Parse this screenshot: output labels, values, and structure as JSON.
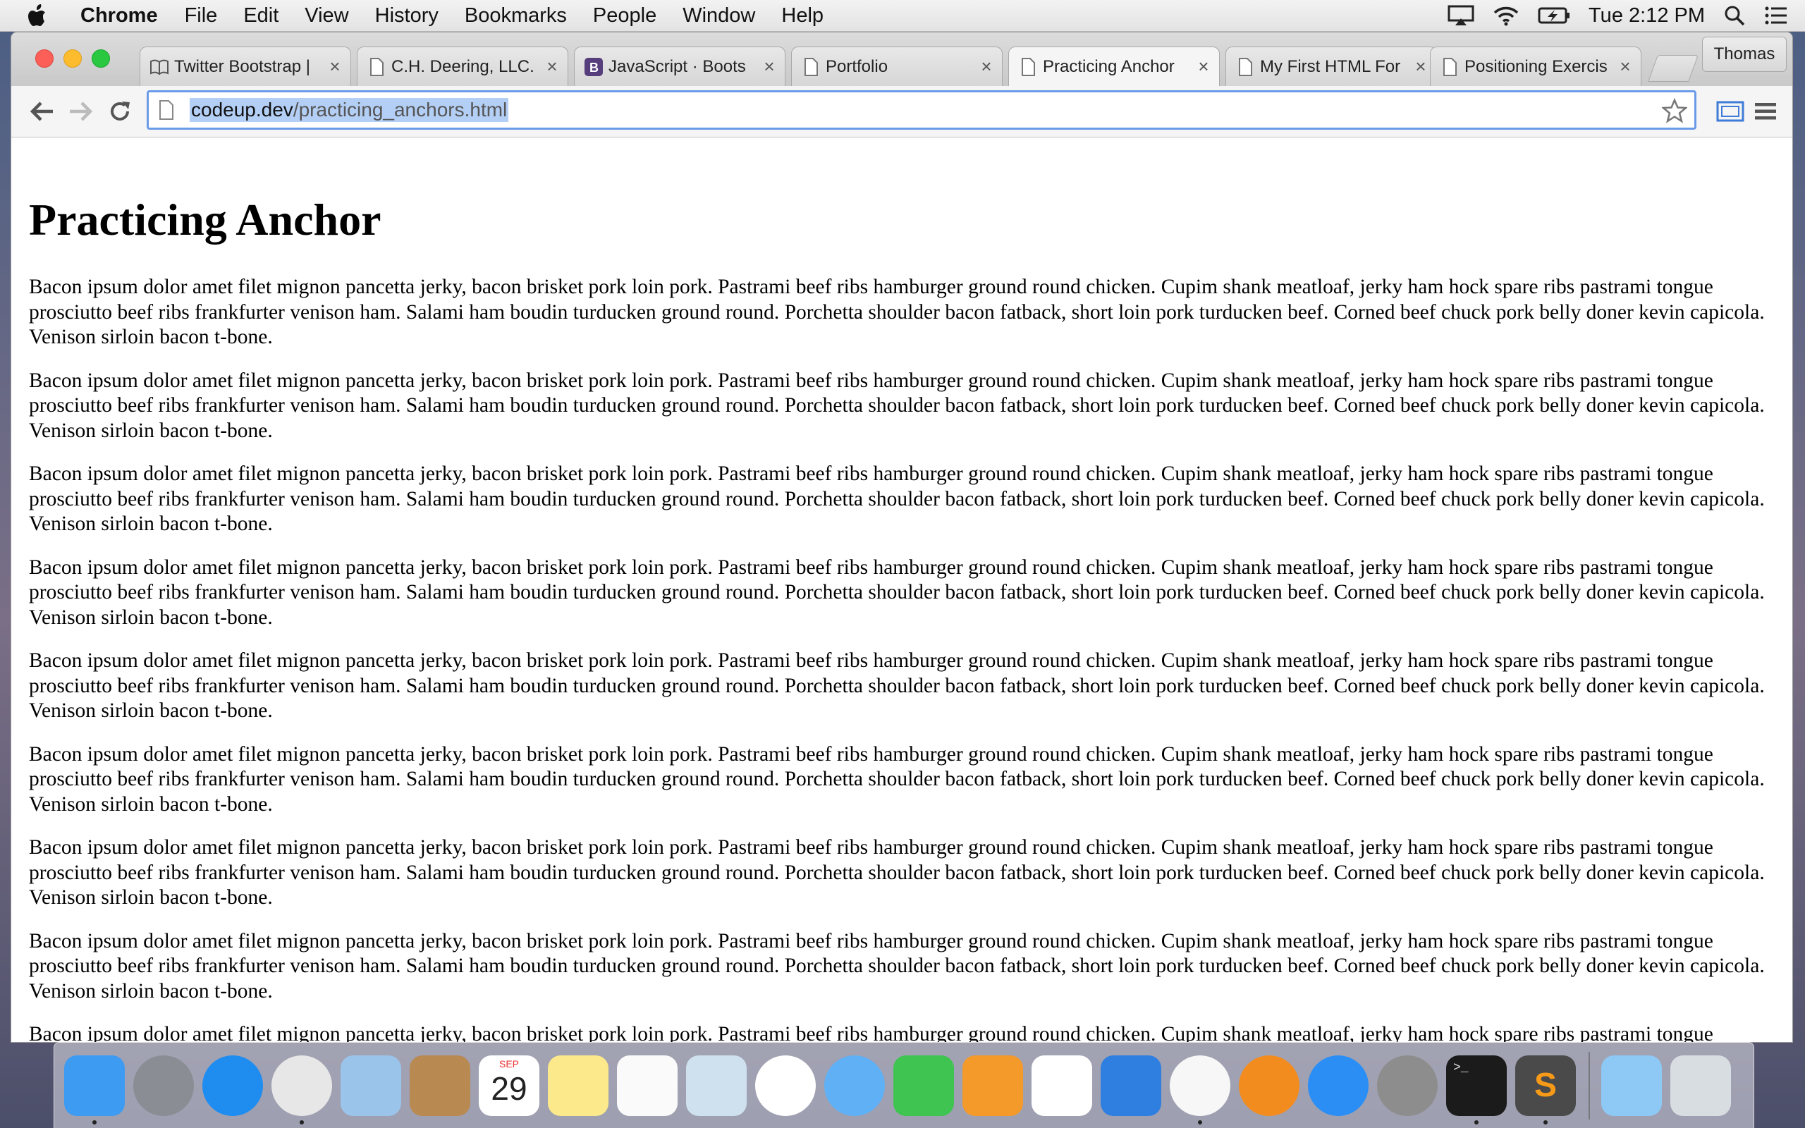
{
  "menubar": {
    "app_name": "Chrome",
    "items": [
      "File",
      "Edit",
      "View",
      "History",
      "Bookmarks",
      "People",
      "Window",
      "Help"
    ],
    "clock": "Tue 2:12 PM"
  },
  "tabs": [
    {
      "title": "Twitter Bootstrap |",
      "favicon": "book-icon"
    },
    {
      "title": "C.H. Deering, LLC.",
      "favicon": "page-icon"
    },
    {
      "title": "JavaScript · Boots",
      "favicon": "bootstrap-icon"
    },
    {
      "title": "Portfolio",
      "favicon": "page-icon"
    },
    {
      "title": "Practicing Anchor",
      "favicon": "page-icon",
      "active": true
    },
    {
      "title": "My First HTML For",
      "favicon": "page-icon"
    },
    {
      "title": "Positioning Exercis",
      "favicon": "page-icon"
    }
  ],
  "profile": "Thomas",
  "address": {
    "host": "codeup.dev",
    "path": "/practicing_anchors.html"
  },
  "page": {
    "heading": "Practicing Anchor",
    "paragraph": "Bacon ipsum dolor amet filet mignon pancetta jerky, bacon brisket pork loin pork. Pastrami beef ribs hamburger ground round chicken. Cupim shank meatloaf, jerky ham hock spare ribs pastrami tongue prosciutto beef ribs frankfurter venison ham. Salami ham boudin turducken ground round. Porchetta shoulder bacon fatback, short loin pork turducken beef. Corned beef chuck pork belly doner kevin capicola. Venison sirloin bacon t-bone.",
    "paragraph_count": 9
  },
  "dock": [
    {
      "name": "finder",
      "color": "#3d9bf2",
      "running": true
    },
    {
      "name": "launchpad",
      "color": "#8a8d94",
      "running": false
    },
    {
      "name": "safari",
      "color": "#1f8cf0",
      "running": false
    },
    {
      "name": "chrome",
      "color": "#e7e7e7",
      "running": true
    },
    {
      "name": "mail",
      "color": "#9ac4ea",
      "running": false
    },
    {
      "name": "contacts",
      "color": "#b88a52",
      "running": false
    },
    {
      "name": "calendar",
      "color": "#ffffff",
      "running": false,
      "month": "SEP",
      "day": "29"
    },
    {
      "name": "notes",
      "color": "#fbe98b",
      "running": false
    },
    {
      "name": "reminders",
      "color": "#fafafa",
      "running": false
    },
    {
      "name": "preview",
      "color": "#cfe0ef",
      "running": false
    },
    {
      "name": "photos",
      "color": "#ffffff",
      "running": false
    },
    {
      "name": "messages",
      "color": "#5fb0f5",
      "running": false
    },
    {
      "name": "facetime",
      "color": "#3fc451",
      "running": false
    },
    {
      "name": "pages",
      "color": "#f39a2b",
      "running": false
    },
    {
      "name": "numbers",
      "color": "#ffffff",
      "running": false
    },
    {
      "name": "keynote",
      "color": "#2f7fe0",
      "running": false
    },
    {
      "name": "itunes",
      "color": "#f7f7f7",
      "running": true
    },
    {
      "name": "ibooks",
      "color": "#f28c1f",
      "running": false
    },
    {
      "name": "app-store",
      "color": "#2a8ef5",
      "running": false
    },
    {
      "name": "system-preferences",
      "color": "#8d8d8d",
      "running": false
    },
    {
      "name": "terminal",
      "color": "#1b1b1b",
      "running": true
    },
    {
      "name": "sublime-text",
      "color": "#4a4a4a",
      "running": true
    }
  ],
  "dock_right": [
    {
      "name": "downloads-folder",
      "color": "#8ec8f4"
    },
    {
      "name": "trash",
      "color": "#d8dde2"
    }
  ]
}
